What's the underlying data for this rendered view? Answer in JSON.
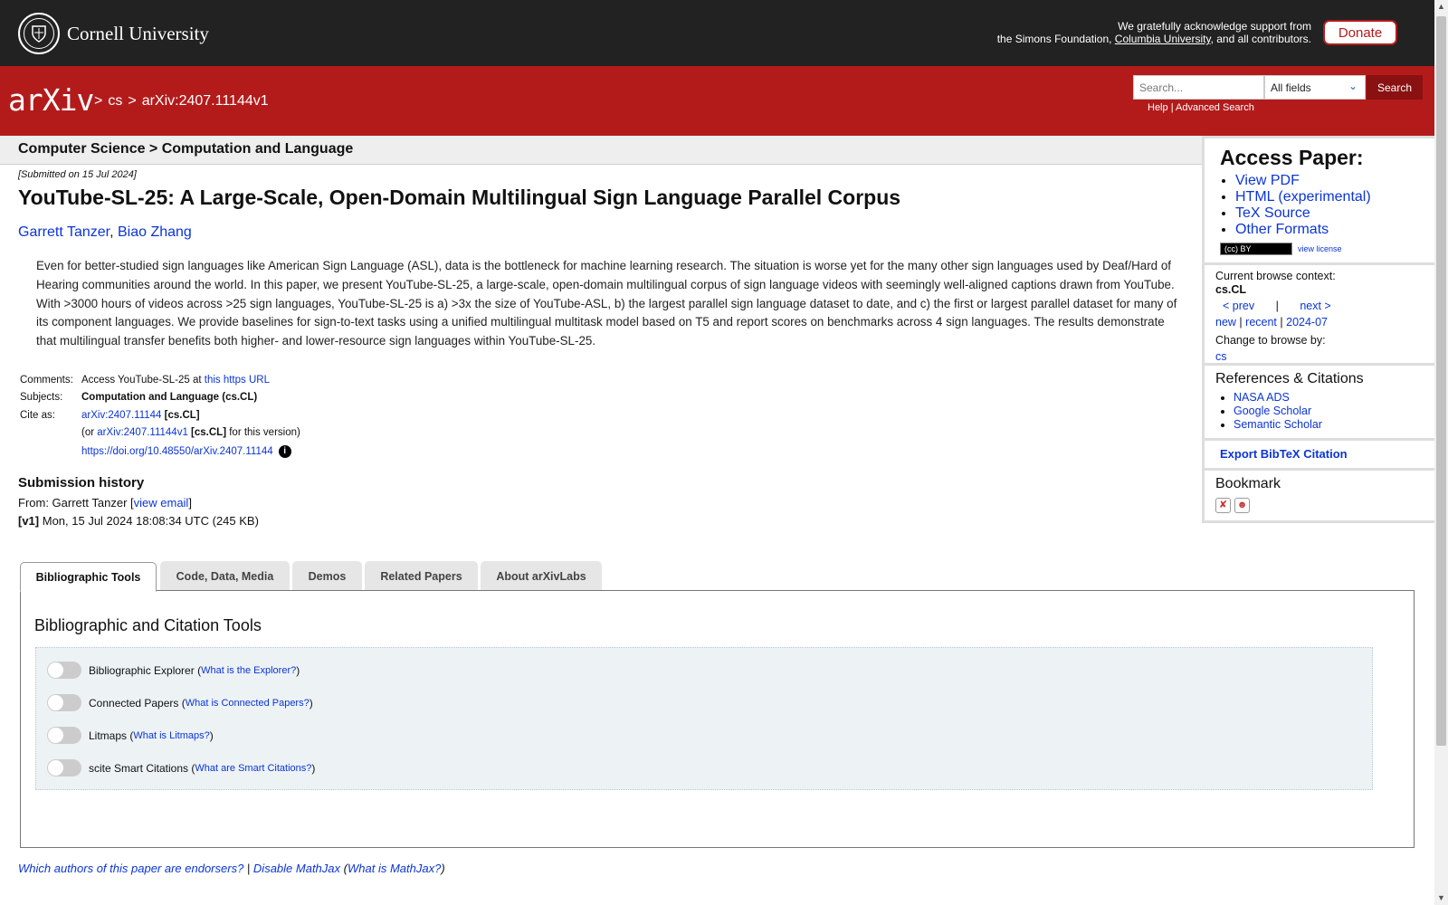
{
  "topbar": {
    "institution": "Cornell University",
    "support_line1": "We gratefully acknowledge support from",
    "support_line2_pre": "the Simons Foundation, ",
    "support_link": "Columbia University",
    "support_line2_post": ", and all contributors.",
    "donate_label": "Donate"
  },
  "header": {
    "logo_text": "arXiv",
    "breadcrumb": [
      ">",
      "cs",
      ">",
      "arXiv:2407.11144v1"
    ],
    "search_placeholder": "Search...",
    "search_field_selected": "All fields",
    "search_button": "Search",
    "help_label": "Help",
    "separator": "|",
    "advanced_label": "Advanced Search"
  },
  "subject_header": "Computer Science > Computation and Language",
  "paper": {
    "dateline": "[Submitted on 15 Jul 2024]",
    "title": "YouTube-SL-25: A Large-Scale, Open-Domain Multilingual Sign Language Parallel Corpus",
    "authors": [
      "Garrett Tanzer",
      "Biao Zhang"
    ],
    "author_sep": ", ",
    "abstract": "Even for better-studied sign languages like American Sign Language (ASL), data is the bottleneck for machine learning research. The situation is worse yet for the many other sign languages used by Deaf/Hard of Hearing communities around the world. In this paper, we present YouTube-SL-25, a large-scale, open-domain multilingual corpus of sign language videos with seemingly well-aligned captions drawn from YouTube. With >3000 hours of videos across >25 sign languages, YouTube-SL-25 is a) >3x the size of YouTube-ASL, b) the largest parallel sign language dataset to date, and c) the first or largest parallel dataset for many of its component languages. We provide baselines for sign-to-text tasks using a unified multilingual multitask model based on T5 and report scores on benchmarks across 4 sign languages. The results demonstrate that multilingual transfer benefits both higher- and lower-resource sign languages within YouTube-SL-25."
  },
  "meta": {
    "comments_label": "Comments:",
    "comments_text": "Access YouTube-SL-25 at ",
    "comments_link": "this https URL",
    "subjects_label": "Subjects:",
    "subjects_value": "Computation and Language (cs.CL)",
    "cite_label": "Cite as:",
    "cite_id": "arXiv:2407.11144",
    "cite_cat": "[cs.CL]",
    "cite_or": "(or ",
    "cite_version_id": "arXiv:2407.11144v1",
    "cite_version_cat": "[cs.CL]",
    "cite_version_post": " for this version)",
    "doi": "https://doi.org/10.48550/arXiv.2407.11144"
  },
  "history": {
    "title": "Submission history",
    "from_pre": "From: Garrett Tanzer [",
    "view_email": "view email",
    "from_post": "]",
    "v1_label": "[v1]",
    "v1_text": " Mon, 15 Jul 2024 18:08:34 UTC (245 KB)"
  },
  "sidebar": {
    "access_title": "Access Paper:",
    "access_links": [
      "View PDF",
      "HTML (experimental)",
      "TeX Source",
      "Other Formats"
    ],
    "license_badge": "(cc) BY",
    "view_license": "view license",
    "browse_context_label": "Current browse context:",
    "browse_context": "cs.CL",
    "prev": "< prev",
    "pipe": "|",
    "next": "next >",
    "new": "new",
    "recent": "recent",
    "month": "2024-07",
    "change_browse": "Change to browse by:",
    "browse_cs": "cs",
    "refs_title": "References & Citations",
    "refs_links": [
      "NASA ADS",
      "Google Scholar",
      "Semantic Scholar"
    ],
    "export_bibtex": "Export BibTeX Citation",
    "bookmark_title": "Bookmark"
  },
  "tabs": [
    "Bibliographic Tools",
    "Code, Data, Media",
    "Demos",
    "Related Papers",
    "About arXivLabs"
  ],
  "tools": {
    "title": "Bibliographic and Citation Tools",
    "items": [
      {
        "label": "Bibliographic Explorer",
        "link": "What is the Explorer?"
      },
      {
        "label": "Connected Papers",
        "link": "What is Connected Papers?"
      },
      {
        "label": "Litmaps",
        "link": "What is Litmaps?"
      },
      {
        "label": "scite Smart Citations",
        "link": "What are Smart Citations?"
      }
    ]
  },
  "footer": {
    "endorsers": "Which authors of this paper are endorsers?",
    "sep": " | ",
    "disable_mathjax": "Disable MathJax",
    "mathjax_open": " (",
    "what_mathjax": "What is MathJax?",
    "mathjax_close": ")"
  },
  "colors": {
    "arxiv_red": "#b31b1b",
    "cornell_bar": "#222222",
    "link_blue": "#0b35d6"
  }
}
